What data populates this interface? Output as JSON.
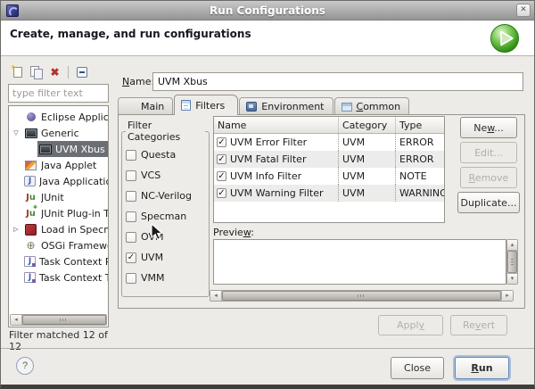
{
  "window": {
    "title": "Run Configurations",
    "close_glyph": "✕"
  },
  "header": {
    "subtitle": "Create, manage, and run configurations"
  },
  "sidebar": {
    "toolbar_icons": [
      "new-config-icon",
      "duplicate-config-icon",
      "delete-config-icon",
      "collapse-all-icon"
    ],
    "filter_placeholder": "type filter text",
    "tree": [
      {
        "label": "Eclipse Application",
        "icon": "eclipse-application",
        "indent": 1
      },
      {
        "label": "Generic",
        "icon": "generic",
        "indent": 0,
        "expander": "open"
      },
      {
        "label": "UVM Xbus",
        "icon": "generic",
        "indent": 2,
        "selected": true
      },
      {
        "label": "Java Applet",
        "icon": "java-applet",
        "indent": 1
      },
      {
        "label": "Java Application",
        "icon": "java-application",
        "indent": 1
      },
      {
        "label": "JUnit",
        "icon": "junit",
        "indent": 1
      },
      {
        "label": "JUnit Plug-in Test",
        "icon": "junit-plugin",
        "indent": 1
      },
      {
        "label": "Load in Specman",
        "icon": "specman",
        "indent": 0,
        "expander": "closed"
      },
      {
        "label": "OSGi Framework",
        "icon": "osgi",
        "indent": 1
      },
      {
        "label": "Task Context Plug-in Test",
        "icon": "task-context",
        "indent": 1
      },
      {
        "label": "Task Context Test",
        "icon": "task-context",
        "indent": 1
      }
    ],
    "status": "Filter matched 12 of 12"
  },
  "main": {
    "name_label": {
      "text": "Name:",
      "mn": "N"
    },
    "name_value": "UVM Xbus",
    "tabs": [
      {
        "label": "Main",
        "icon": "main",
        "active": false
      },
      {
        "label": "Filters",
        "icon": "filters",
        "active": true
      },
      {
        "label": "Environment",
        "icon": "environment",
        "active": false
      },
      {
        "label": "Common",
        "icon": "common",
        "active": false,
        "mn": "C"
      }
    ],
    "filter_categories": {
      "title": "Filter Categories",
      "items": [
        {
          "label": "Questa",
          "checked": false
        },
        {
          "label": "VCS",
          "checked": false
        },
        {
          "label": "NC-Verilog",
          "checked": false
        },
        {
          "label": "Specman",
          "checked": false
        },
        {
          "label": "OVM",
          "checked": false
        },
        {
          "label": "UVM",
          "checked": true
        },
        {
          "label": "VMM",
          "checked": false
        }
      ]
    },
    "filters_table": {
      "columns": [
        "Name",
        "Category",
        "Type"
      ],
      "rows": [
        {
          "checked": true,
          "name": "UVM Error Filter",
          "category": "UVM",
          "type": "ERROR"
        },
        {
          "checked": true,
          "name": "UVM Fatal Filter",
          "category": "UVM",
          "type": "ERROR"
        },
        {
          "checked": true,
          "name": "UVM Info Filter",
          "category": "UVM",
          "type": "NOTE"
        },
        {
          "checked": true,
          "name": "UVM Warning Filter",
          "category": "UVM",
          "type": "WARNING"
        }
      ]
    },
    "actions": [
      {
        "label": "New...",
        "mn": "w",
        "enabled": true
      },
      {
        "label": "Edit...",
        "enabled": false
      },
      {
        "label": "Remove",
        "mn": "R",
        "enabled": false
      },
      {
        "label": "Duplicate...",
        "enabled": true
      }
    ],
    "preview_label": {
      "text": "Preview:",
      "mn": "w"
    },
    "apply": {
      "text": "Apply",
      "mn": "y",
      "enabled": false
    },
    "revert": {
      "text": "Revert",
      "mn": "v",
      "enabled": false
    }
  },
  "footer": {
    "help_glyph": "?",
    "close": {
      "text": "Close"
    },
    "run": {
      "text": "Run",
      "mn": "R"
    }
  },
  "colors": {
    "selection_bg": "#6b6e74",
    "run_accent_green": "#3f9f20",
    "delete_red": "#b5342c",
    "window_bg": "#edebe7"
  }
}
